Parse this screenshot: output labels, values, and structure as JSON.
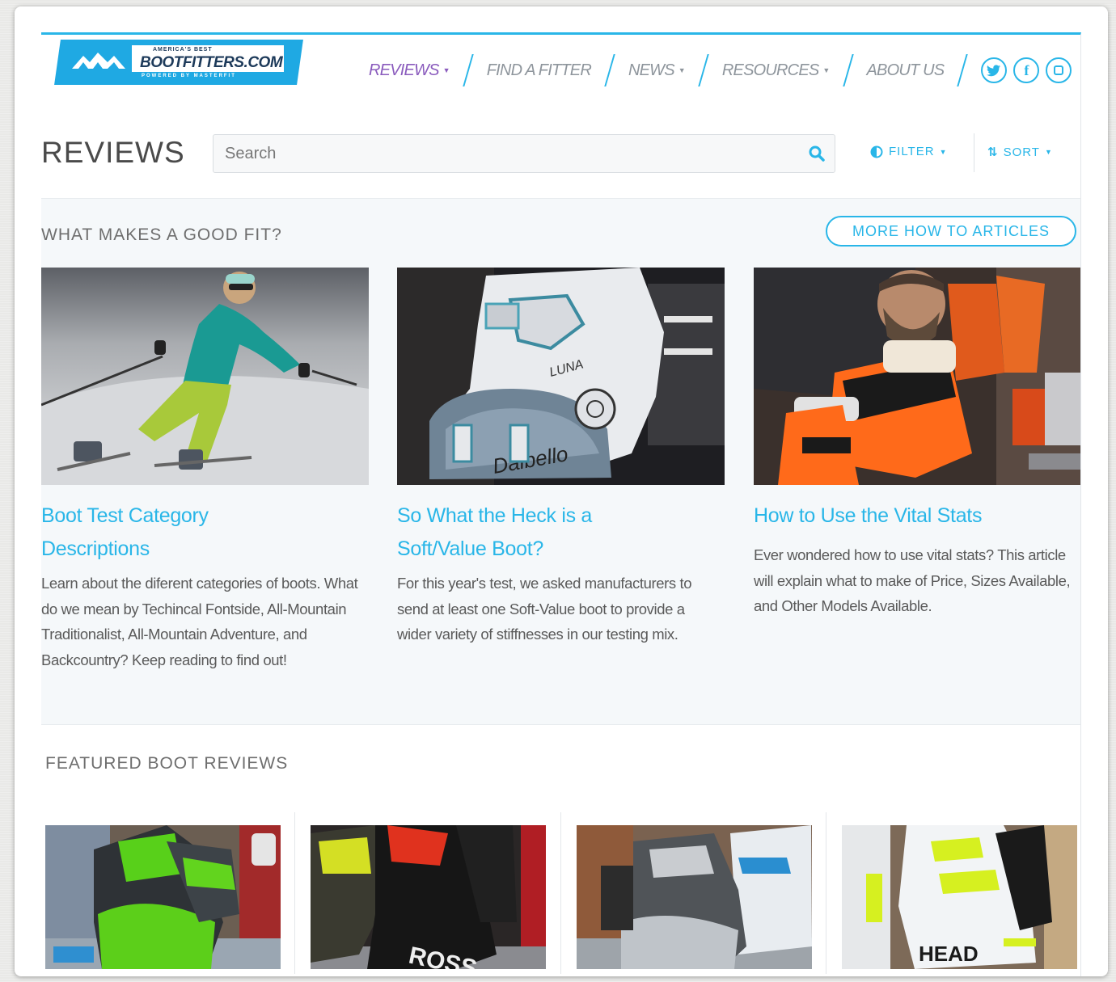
{
  "brand": {
    "logo_top": "AMERICA'S BEST",
    "logo_main": "BOOTFITTERS.COM",
    "logo_sub": "POWERED BY MASTERFIT"
  },
  "nav": {
    "items": [
      {
        "label": "REVIEWS",
        "has_dropdown": true,
        "active": true
      },
      {
        "label": "FIND A FITTER",
        "has_dropdown": false,
        "active": false
      },
      {
        "label": "NEWS",
        "has_dropdown": true,
        "active": false
      },
      {
        "label": "RESOURCES",
        "has_dropdown": true,
        "active": false
      },
      {
        "label": "ABOUT US",
        "has_dropdown": false,
        "active": false
      }
    ],
    "social": [
      "twitter-icon",
      "facebook-icon",
      "instagram-icon"
    ]
  },
  "reviews": {
    "title": "REVIEWS",
    "search_placeholder": "Search",
    "filter_label": "FILTER",
    "sort_label": "SORT"
  },
  "good_fit": {
    "heading": "WHAT MAKES A GOOD FIT?",
    "more_button": "MORE HOW TO ARTICLES",
    "articles": [
      {
        "title": "Boot Test Category Descriptions",
        "description": "Learn about the diferent categories of boots. What do we mean by Techincal Fontside, All-Mountain Traditionalist, All-Mountain Adventure, and Backcountry? Keep reading to find out!"
      },
      {
        "title": "So What the Heck is a Soft/Value Boot?",
        "description": "For this year's test, we asked manufacturers to send at least one Soft-Value boot to provide a wider variety of stiffnesses in our testing mix."
      },
      {
        "title": "How to Use the Vital Stats",
        "description": "Ever wondered how to use vital stats? This article will explain what to make of Price, Sizes Available, and Other Models Available."
      }
    ]
  },
  "featured": {
    "heading": "FEATURED BOOT REVIEWS",
    "boot_images": [
      "green-boot-image",
      "black-red-boot-image",
      "gray-white-boot-image",
      "head-white-boot-image"
    ]
  },
  "colors": {
    "accent": "#29b6e8",
    "nav_active": "#8a5bbd",
    "nav_text": "#8e959c",
    "section_bg": "#f5f8fa"
  }
}
